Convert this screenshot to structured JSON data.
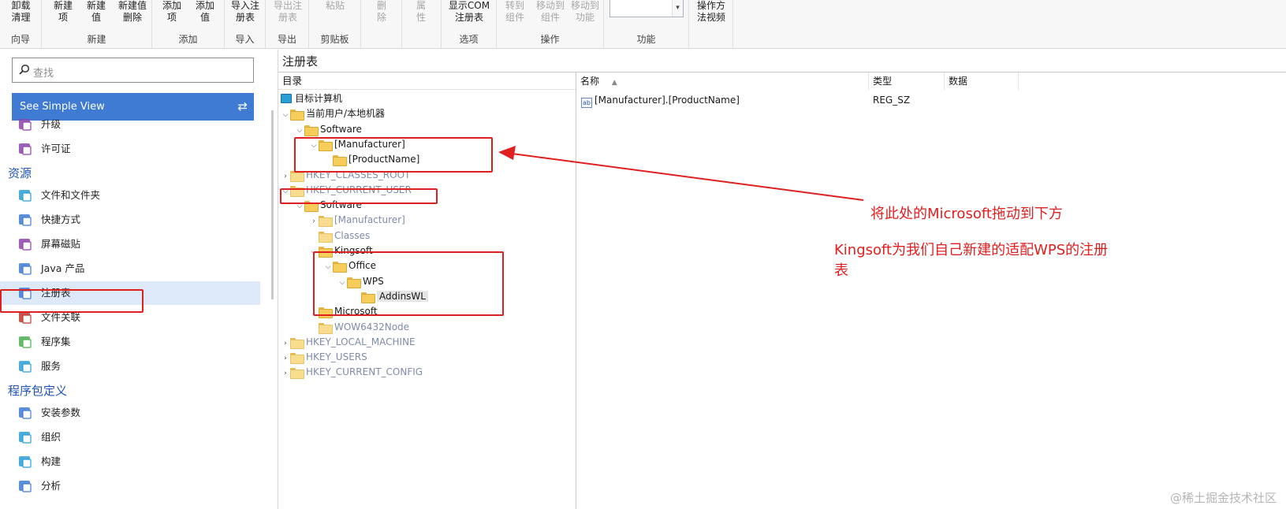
{
  "ribbon": {
    "groups": [
      {
        "label": "向导",
        "buttons": [
          {
            "text": "卸载\n清理",
            "disabled": false
          }
        ]
      },
      {
        "label": "新建",
        "buttons": [
          {
            "text": "新建\n项",
            "disabled": false
          },
          {
            "text": "新建\n值",
            "disabled": false
          },
          {
            "text": "新建值\n删除",
            "disabled": false
          }
        ]
      },
      {
        "label": "添加",
        "buttons": [
          {
            "text": "添加\n项",
            "disabled": false
          },
          {
            "text": "添加\n值",
            "disabled": false
          }
        ]
      },
      {
        "label": "导入",
        "buttons": [
          {
            "text": "导入注\n册表",
            "disabled": false
          }
        ]
      },
      {
        "label": "导出",
        "buttons": [
          {
            "text": "导出注\n册表",
            "disabled": true
          }
        ]
      },
      {
        "label": "剪贴板",
        "buttons": [
          {
            "text": "粘贴",
            "disabled": true
          }
        ]
      },
      {
        "label": "",
        "buttons": [
          {
            "text": "删\n除",
            "disabled": true
          }
        ]
      },
      {
        "label": "",
        "buttons": [
          {
            "text": "属\n性",
            "disabled": true
          }
        ]
      },
      {
        "label": "选项",
        "buttons": [
          {
            "text": "显示COM\n注册表",
            "disabled": false
          }
        ]
      },
      {
        "label": "操作",
        "buttons": [
          {
            "text": "转到\n组件",
            "disabled": true
          },
          {
            "text": "移动到\n组件",
            "disabled": true
          },
          {
            "text": "移动到\n功能",
            "disabled": true
          }
        ]
      },
      {
        "label": "功能",
        "buttons": []
      },
      {
        "label": "",
        "buttons": [
          {
            "text": "操作方\n法视频",
            "disabled": false
          }
        ]
      }
    ]
  },
  "sidebar": {
    "search_placeholder": "查找",
    "simple_view": "See Simple View",
    "items_top": [
      {
        "label": "升级",
        "icon": "upgrade-box-icon"
      },
      {
        "label": "许可证",
        "icon": "license-key-icon"
      }
    ],
    "section_resources": "资源",
    "items_resources": [
      {
        "label": "文件和文件夹",
        "icon": "folder-files-icon"
      },
      {
        "label": "快捷方式",
        "icon": "shortcut-arrow-icon"
      },
      {
        "label": "屏幕磁贴",
        "icon": "screen-tile-icon"
      },
      {
        "label": "Java 产品",
        "icon": "java-cup-icon"
      },
      {
        "label": "注册表",
        "icon": "registry-cubes-icon",
        "selected": true
      },
      {
        "label": "文件关联",
        "icon": "file-association-icon"
      },
      {
        "label": "程序集",
        "icon": "assembly-blocks-icon"
      },
      {
        "label": "服务",
        "icon": "service-gear-icon"
      }
    ],
    "section_package": "程序包定义",
    "items_package": [
      {
        "label": "安装参数",
        "icon": "install-params-icon"
      },
      {
        "label": "组织",
        "icon": "organization-icon"
      },
      {
        "label": "构建",
        "icon": "build-bricks-icon"
      },
      {
        "label": "分析",
        "icon": "analysis-chart-icon"
      }
    ]
  },
  "main": {
    "title": "注册表",
    "tree_header": "目录",
    "tree": [
      {
        "text": "目标计算机",
        "level": 0,
        "expander": "",
        "kind": "computer",
        "dim": false
      },
      {
        "text": "当前用户/本地机器",
        "level": 1,
        "expander": "open",
        "kind": "folder",
        "dim": false
      },
      {
        "text": "Software",
        "level": 2,
        "expander": "open",
        "kind": "folder",
        "dim": false
      },
      {
        "text": "[Manufacturer]",
        "level": 3,
        "expander": "open",
        "kind": "folder",
        "dim": false
      },
      {
        "text": "[ProductName]",
        "level": 4,
        "expander": "",
        "kind": "folder",
        "dim": false
      },
      {
        "text": "HKEY_CLASSES_ROOT",
        "level": 1,
        "expander": "closed",
        "kind": "folder",
        "dim": true
      },
      {
        "text": "HKEY_CURRENT_USER",
        "level": 1,
        "expander": "open",
        "kind": "folder",
        "dim": true
      },
      {
        "text": "Software",
        "level": 2,
        "expander": "open",
        "kind": "folder",
        "dim": false
      },
      {
        "text": "[Manufacturer]",
        "level": 3,
        "expander": "closed",
        "kind": "folder",
        "dim": true
      },
      {
        "text": "Classes",
        "level": 3,
        "expander": "",
        "kind": "folder",
        "dim": true
      },
      {
        "text": "Kingsoft",
        "level": 3,
        "expander": "open",
        "kind": "folder",
        "dim": false
      },
      {
        "text": "Office",
        "level": 4,
        "expander": "open",
        "kind": "folder",
        "dim": false
      },
      {
        "text": "WPS",
        "level": 5,
        "expander": "open",
        "kind": "folder",
        "dim": false
      },
      {
        "text": "AddinsWL",
        "level": 6,
        "expander": "",
        "kind": "folder",
        "dim": false,
        "selected": true
      },
      {
        "text": "Microsoft",
        "level": 3,
        "expander": "closed",
        "kind": "folder",
        "dim": false
      },
      {
        "text": "WOW6432Node",
        "level": 3,
        "expander": "",
        "kind": "folder",
        "dim": true
      },
      {
        "text": "HKEY_LOCAL_MACHINE",
        "level": 1,
        "expander": "closed",
        "kind": "folder",
        "dim": true
      },
      {
        "text": "HKEY_USERS",
        "level": 1,
        "expander": "closed",
        "kind": "folder",
        "dim": true
      },
      {
        "text": "HKEY_CURRENT_CONFIG",
        "level": 1,
        "expander": "closed",
        "kind": "folder",
        "dim": true
      }
    ],
    "list_columns": {
      "name": "名称",
      "type": "类型",
      "data": "数据"
    },
    "list_rows": [
      {
        "name": "[Manufacturer].[ProductName]",
        "type": "REG_SZ",
        "data": ""
      }
    ]
  },
  "annotations": {
    "note1": "将此处的Microsoft拖动到下方",
    "note2": "Kingsoft为我们自己新建的适配WPS的注册\n表",
    "color": "#e02020"
  },
  "watermark": "@稀土掘金技术社区"
}
